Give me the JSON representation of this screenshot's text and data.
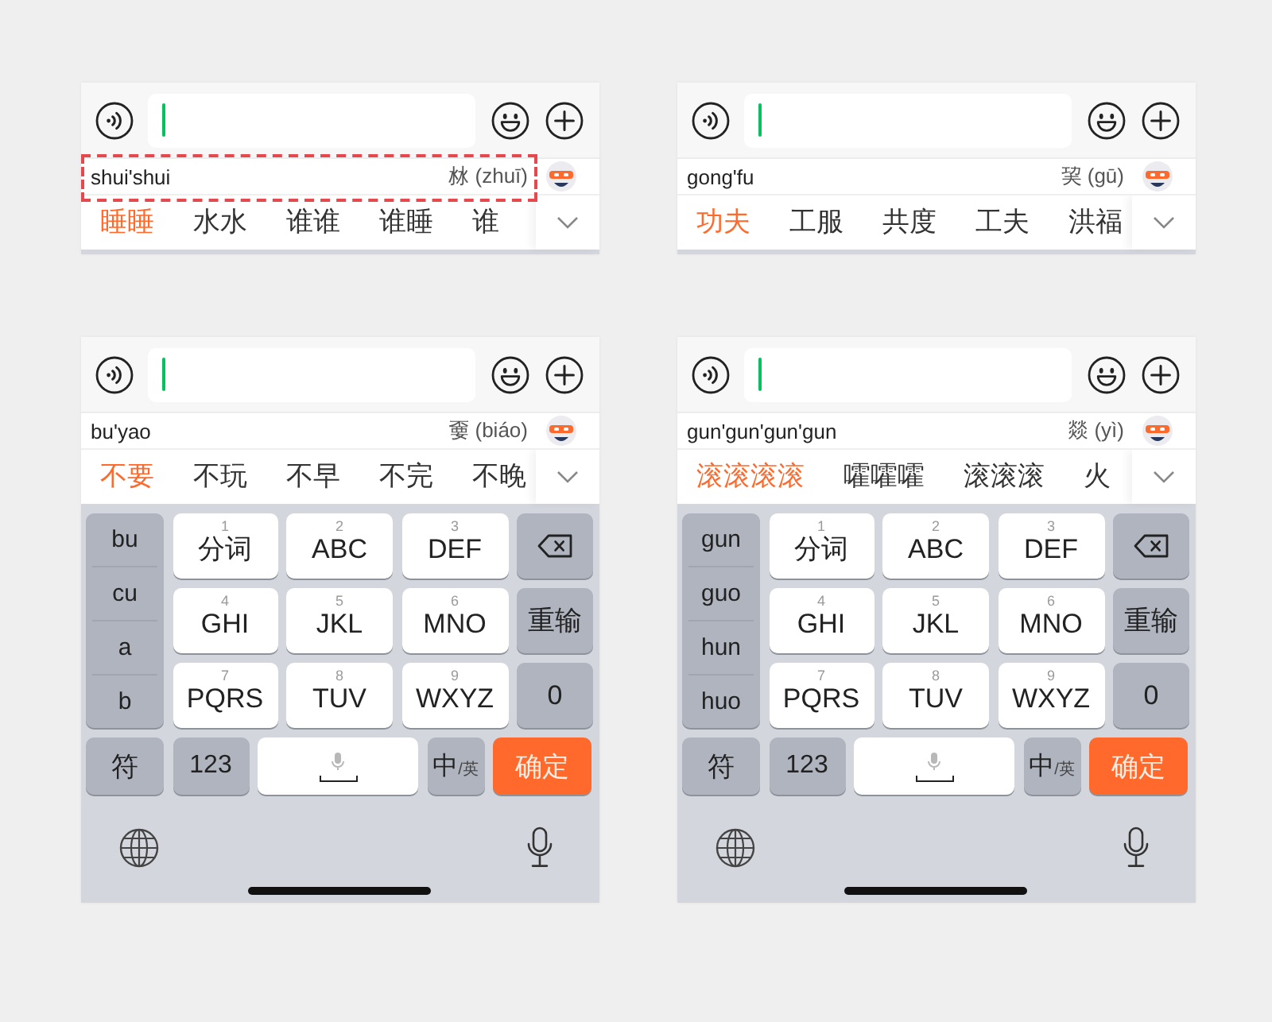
{
  "panels": [
    {
      "input": {
        "focused": true
      },
      "composition": {
        "pinyin": "shui'shui",
        "hint": "沝 (zhuī)",
        "highlighted": true
      },
      "candidates": [
        {
          "text": "睡睡",
          "selected": true
        },
        {
          "text": "水水",
          "selected": false
        },
        {
          "text": "谁谁",
          "selected": false
        },
        {
          "text": "谁睡",
          "selected": false
        },
        {
          "text": "谁",
          "selected": false
        }
      ]
    },
    {
      "input": {
        "focused": true
      },
      "composition": {
        "pinyin": "gong'fu",
        "hint": "巭 (gū)",
        "highlighted": false
      },
      "candidates": [
        {
          "text": "功夫",
          "selected": true
        },
        {
          "text": "工服",
          "selected": false
        },
        {
          "text": "共度",
          "selected": false
        },
        {
          "text": "工夫",
          "selected": false
        },
        {
          "text": "洪福",
          "selected": false
        }
      ]
    },
    {
      "input": {
        "focused": true
      },
      "composition": {
        "pinyin": "bu'yao",
        "hint": "嫑 (biáo)",
        "highlighted": false
      },
      "candidates": [
        {
          "text": "不要",
          "selected": true
        },
        {
          "text": "不玩",
          "selected": false
        },
        {
          "text": "不早",
          "selected": false
        },
        {
          "text": "不完",
          "selected": false
        },
        {
          "text": "不晚",
          "selected": false
        }
      ],
      "keyboard": {
        "syllables": [
          "bu",
          "cu",
          "a",
          "b"
        ],
        "keys": [
          {
            "kind": "letters",
            "digit": "1",
            "label": "分词"
          },
          {
            "kind": "letters",
            "digit": "2",
            "label": "ABC"
          },
          {
            "kind": "letters",
            "digit": "3",
            "label": "DEF"
          },
          {
            "kind": "backspace"
          },
          {
            "kind": "letters",
            "digit": "4",
            "label": "GHI"
          },
          {
            "kind": "letters",
            "digit": "5",
            "label": "JKL"
          },
          {
            "kind": "letters",
            "digit": "6",
            "label": "MNO"
          },
          {
            "kind": "function",
            "label": "重输"
          },
          {
            "kind": "letters",
            "digit": "7",
            "label": "PQRS"
          },
          {
            "kind": "letters",
            "digit": "8",
            "label": "TUV"
          },
          {
            "kind": "letters",
            "digit": "9",
            "label": "WXYZ"
          },
          {
            "kind": "function",
            "label": "0"
          }
        ],
        "bottom_keys": [
          {
            "kind": "function",
            "label": "符"
          },
          {
            "kind": "function",
            "label": "123"
          },
          {
            "kind": "space"
          },
          {
            "kind": "language",
            "label": "中",
            "sub_label": "/英"
          },
          {
            "kind": "confirm",
            "label": "确定"
          }
        ]
      }
    },
    {
      "input": {
        "focused": true
      },
      "composition": {
        "pinyin": "gun'gun'gun'gun",
        "hint": "燚 (yì)",
        "highlighted": false
      },
      "candidates": [
        {
          "text": "滚滚滚滚",
          "selected": true
        },
        {
          "text": "嚯嚯嚯",
          "selected": false
        },
        {
          "text": "滚滚滚",
          "selected": false
        },
        {
          "text": "火",
          "selected": false
        }
      ],
      "keyboard": {
        "syllables": [
          "gun",
          "guo",
          "hun",
          "huo"
        ],
        "keys": [
          {
            "kind": "letters",
            "digit": "1",
            "label": "分词"
          },
          {
            "kind": "letters",
            "digit": "2",
            "label": "ABC"
          },
          {
            "kind": "letters",
            "digit": "3",
            "label": "DEF"
          },
          {
            "kind": "backspace"
          },
          {
            "kind": "letters",
            "digit": "4",
            "label": "GHI"
          },
          {
            "kind": "letters",
            "digit": "5",
            "label": "JKL"
          },
          {
            "kind": "letters",
            "digit": "6",
            "label": "MNO"
          },
          {
            "kind": "function",
            "label": "重输"
          },
          {
            "kind": "letters",
            "digit": "7",
            "label": "PQRS"
          },
          {
            "kind": "letters",
            "digit": "8",
            "label": "TUV"
          },
          {
            "kind": "letters",
            "digit": "9",
            "label": "WXYZ"
          },
          {
            "kind": "function",
            "label": "0"
          }
        ],
        "bottom_keys": [
          {
            "kind": "function",
            "label": "符"
          },
          {
            "kind": "function",
            "label": "123"
          },
          {
            "kind": "space"
          },
          {
            "kind": "language",
            "label": "中",
            "sub_label": "/英"
          },
          {
            "kind": "confirm",
            "label": "确定"
          }
        ]
      }
    }
  ]
}
